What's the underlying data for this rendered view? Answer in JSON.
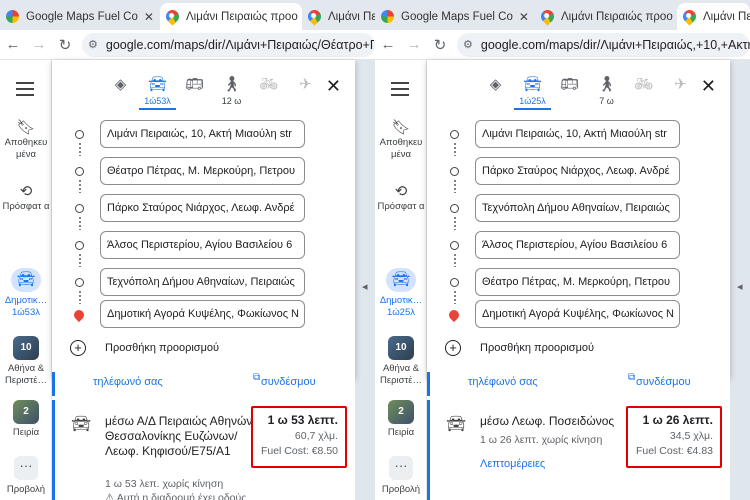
{
  "left": {
    "tabs": [
      {
        "label": "Google Maps Fuel Co"
      },
      {
        "label": "Λιμάνι Πειραιώς προο"
      },
      {
        "label": "Λιμάνι Πειρ"
      }
    ],
    "url": "google.com/maps/dir/Λιμάνι+Πειραιώς/Θέατρο+Πέτρ",
    "rail": {
      "saved": "Αποθηκευ μένα",
      "recent": "Πρόσφατ α",
      "current_line1": "Δημοτικ…",
      "current_line2": "1ώ53λ",
      "recent1_badge": "10",
      "recent1_label": "Αθήνα & Περιστέ…",
      "recent2_badge": "2",
      "recent2_label": "Πειρία",
      "more_label": "Προβολή"
    },
    "modes": {
      "car": "1ώ53λ",
      "walk": "12 ω"
    },
    "stops": [
      "Λιμάνι Πειραιώς, 10, Ακτή Μιαούλη str",
      "Θέατρο Πέτρας, Μ. Μερκούρη, Πετρου",
      "Πάρκο Σταύρος Νιάρχος, Λεωφ. Ανδρέ",
      "Άλσος Περιστερίου, Αγίου Βασιλείου 6",
      "Τεχνόπολη Δήμου Αθηναίων, Πειραιώς",
      "Δημοτική Αγορά Κυψέλης, Φωκίωνος Ν"
    ],
    "add_stop": "Προσθήκη προορισμού",
    "strip_left": "τηλέφωνό σας",
    "strip_right": "συνδέσμου",
    "route": {
      "name": "μέσω Α/Δ Πειραιώς Αθηνών Θεσσαλονίκης Ευζώνων/Λεωφ. Κηφισού/E75/A1",
      "sub": "1 ω 53 λεπ. χωρίς κίνηση",
      "warn": "⚠ Αυτή η διαδρομή έχει οδούς",
      "time": "1 ω 53 λεπτ.",
      "distance": "60,7 χλμ.",
      "fuel": "Fuel Cost: €8.50"
    }
  },
  "right": {
    "tabs": [
      {
        "label": "Google Maps Fuel Co"
      },
      {
        "label": "Λιμάνι Πειραιώς προο"
      },
      {
        "label": "Λιμάνι Πει"
      }
    ],
    "url": "google.com/maps/dir/Λιμάνι+Πειραιώς,+10,+Ακτή+Μι",
    "rail": {
      "saved": "Αποθηκευ μένα",
      "recent": "Πρόσφατ α",
      "current_line1": "Δημοτικ…",
      "current_line2": "1ώ25λ",
      "recent1_badge": "10",
      "recent1_label": "Αθήνα & Περιστέ…",
      "recent2_badge": "2",
      "recent2_label": "Πειρία",
      "more_label": "Προβολή"
    },
    "modes": {
      "car": "1ώ25λ",
      "walk": "7 ω"
    },
    "stops": [
      "Λιμάνι Πειραιώς, 10, Ακτή Μιαούλη str",
      "Πάρκο Σταύρος Νιάρχος, Λεωφ. Ανδρέ",
      "Τεχνόπολη Δήμου Αθηναίων, Πειραιώς",
      "Άλσος Περιστερίου, Αγίου Βασιλείου 6",
      "Θέατρο Πέτρας, Μ. Μερκούρη, Πετρου",
      "Δημοτική Αγορά Κυψέλης, Φωκίωνος Ν"
    ],
    "add_stop": "Προσθήκη προορισμού",
    "strip_left": "τηλέφωνό σας",
    "strip_right": "συνδέσμου",
    "route": {
      "name": "μέσω Λεωφ. Ποσειδώνος",
      "sub": "1 ω 26 λεπτ. χωρίς κίνηση",
      "link": "Λεπτομέρειες",
      "time": "1 ω 26 λεπτ.",
      "distance": "34,5 χλμ.",
      "fuel": "Fuel Cost: €4.83"
    }
  }
}
